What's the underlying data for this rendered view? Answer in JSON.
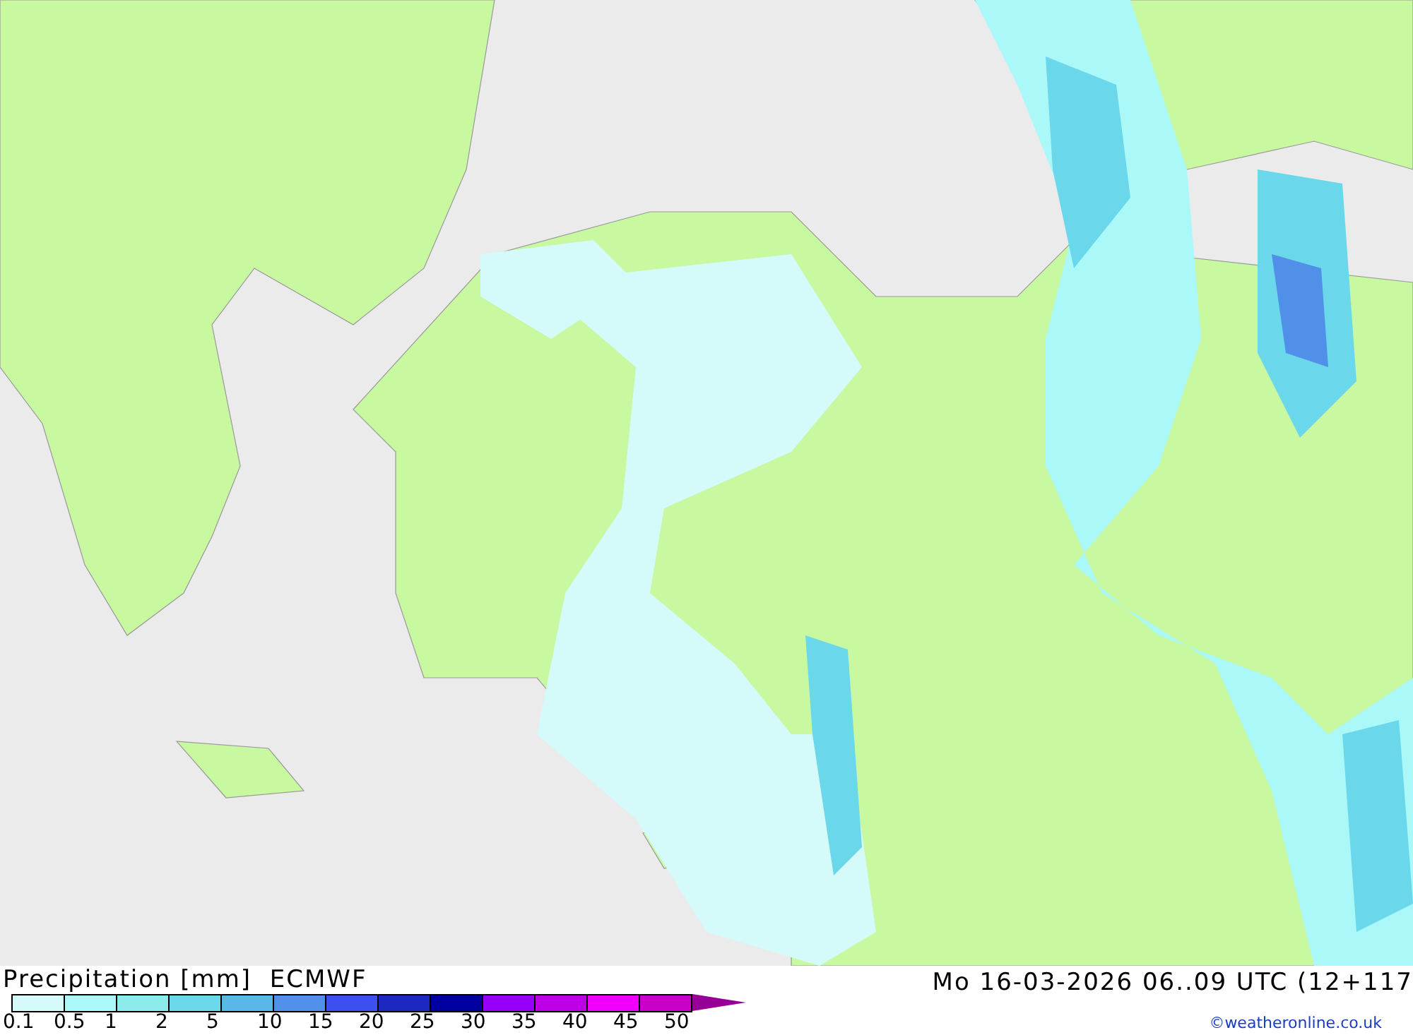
{
  "title": "Precipitation [mm]  ECMWF",
  "valid_time": "Mo 16-03-2026 06..09 UTC (12+117",
  "credit": "©weatheronline.co.uk",
  "scale": {
    "bins": [
      {
        "color": "#d4fafa"
      },
      {
        "color": "#aaf8f8"
      },
      {
        "color": "#8cecec"
      },
      {
        "color": "#6ad8ea"
      },
      {
        "color": "#5ab8e8"
      },
      {
        "color": "#5090e8"
      },
      {
        "color": "#3c50f0"
      },
      {
        "color": "#1c28c0"
      },
      {
        "color": "#0000a0"
      },
      {
        "color": "#9600fa"
      },
      {
        "color": "#be00e6"
      },
      {
        "color": "#f000fa"
      },
      {
        "color": "#c800c8"
      }
    ],
    "ticks": [
      "0.1",
      "0.5",
      "1",
      "2",
      "5",
      "10",
      "15",
      "20",
      "25",
      "30",
      "35",
      "40",
      "45",
      "50"
    ],
    "overflow": {
      "color": "#960096"
    }
  }
}
